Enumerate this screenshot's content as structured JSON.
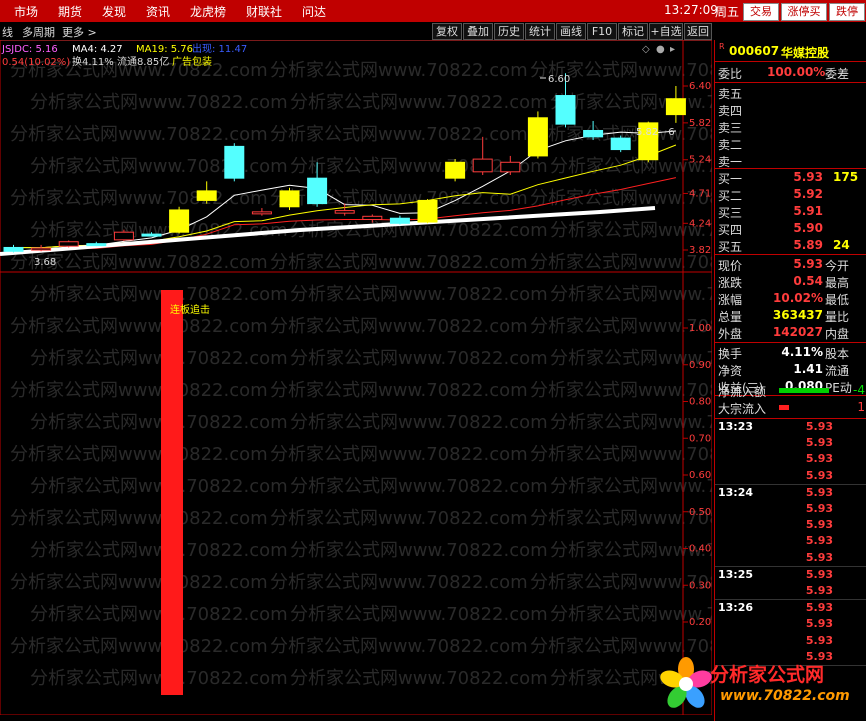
{
  "top_menu": [
    "市场",
    "期货",
    "发现",
    "资讯",
    "龙虎榜",
    "财联社",
    "问达"
  ],
  "clock": "13:27:09",
  "weekday": "周五",
  "top_buttons": [
    "交易",
    "涨停买",
    "跌停"
  ],
  "toolbar": {
    "period_left": "线",
    "period": "多周期",
    "more": "更多 >",
    "buttons": [
      "复权",
      "叠加",
      "历史",
      "统计",
      "画线",
      "F10",
      "标记",
      "+自选",
      "返回"
    ]
  },
  "indicator_line": {
    "name": "JSJDC: 5.16",
    "ma4": "MA4: 4.27",
    "ma19": "MA19: 5.76",
    "extra": "出现: 11.47",
    "change": "0.54(10.02%)",
    "turnover": "换4.11% 流通8.85亿",
    "concept": "广告包装"
  },
  "chart_labels": {
    "high_marker": "6.60",
    "low_marker": "3.68",
    "last_marker": "5.82 - 6",
    "signal_text": "连板追击"
  },
  "chart_data": {
    "type": "candlestick",
    "price_axis_ticks": [
      "6.40",
      "5.82",
      "5.24",
      "4.71",
      "4.24",
      "3.82"
    ],
    "indicator_axis_ticks": [
      "1.00",
      "0.90",
      "0.80",
      "0.70",
      "0.60",
      "0.50",
      "0.40",
      "0.30",
      "0.20"
    ],
    "candles": [
      {
        "o": 3.8,
        "c": 3.86,
        "h": 3.9,
        "l": 3.78,
        "color": "cyan"
      },
      {
        "o": 3.84,
        "c": 3.85,
        "h": 3.9,
        "l": 3.8,
        "color": "red"
      },
      {
        "o": 3.88,
        "c": 3.95,
        "h": 3.97,
        "l": 3.86,
        "color": "red"
      },
      {
        "o": 3.9,
        "c": 3.92,
        "h": 3.95,
        "l": 3.88,
        "color": "cyan"
      },
      {
        "o": 3.98,
        "c": 4.1,
        "h": 4.14,
        "l": 3.96,
        "color": "red"
      },
      {
        "o": 4.06,
        "c": 4.07,
        "h": 4.1,
        "l": 4.04,
        "color": "cyan"
      },
      {
        "o": 4.1,
        "c": 4.45,
        "h": 4.5,
        "l": 4.08,
        "color": "yellow"
      },
      {
        "o": 4.6,
        "c": 4.75,
        "h": 4.9,
        "l": 4.55,
        "color": "yellow"
      },
      {
        "o": 4.95,
        "c": 5.45,
        "h": 5.5,
        "l": 4.9,
        "color": "cyan"
      },
      {
        "o": 4.42,
        "c": 4.4,
        "h": 4.48,
        "l": 4.36,
        "color": "red"
      },
      {
        "o": 4.5,
        "c": 4.75,
        "h": 4.8,
        "l": 4.45,
        "color": "yellow"
      },
      {
        "o": 4.95,
        "c": 4.55,
        "h": 5.2,
        "l": 4.5,
        "color": "cyan"
      },
      {
        "o": 4.4,
        "c": 4.44,
        "h": 4.55,
        "l": 4.36,
        "color": "red"
      },
      {
        "o": 4.3,
        "c": 4.35,
        "h": 4.38,
        "l": 4.25,
        "color": "red"
      },
      {
        "o": 4.32,
        "c": 4.24,
        "h": 4.36,
        "l": 4.22,
        "color": "cyan"
      },
      {
        "o": 4.26,
        "c": 4.6,
        "h": 4.62,
        "l": 4.24,
        "color": "yellow"
      },
      {
        "o": 4.95,
        "c": 5.2,
        "h": 5.25,
        "l": 4.9,
        "color": "yellow"
      },
      {
        "o": 5.05,
        "c": 5.25,
        "h": 5.6,
        "l": 5.0,
        "color": "red"
      },
      {
        "o": 5.05,
        "c": 5.2,
        "h": 5.3,
        "l": 5.0,
        "color": "red"
      },
      {
        "o": 5.3,
        "c": 5.9,
        "h": 6.0,
        "l": 5.26,
        "color": "yellow"
      },
      {
        "o": 6.25,
        "c": 5.8,
        "h": 6.6,
        "l": 5.75,
        "color": "cyan"
      },
      {
        "o": 5.7,
        "c": 5.6,
        "h": 5.85,
        "l": 5.55,
        "color": "cyan"
      },
      {
        "o": 5.58,
        "c": 5.4,
        "h": 5.62,
        "l": 5.36,
        "color": "cyan"
      },
      {
        "o": 5.24,
        "c": 5.82,
        "h": 5.84,
        "l": 5.2,
        "color": "yellow"
      },
      {
        "o": 6.2,
        "c": 5.95,
        "h": 6.4,
        "l": 5.82,
        "color": "yellow"
      }
    ]
  },
  "panel": {
    "code": "000607",
    "name": "华媒控股",
    "weibi_label": "委比",
    "weibi_value": "100.00%",
    "weicha_label": "委差",
    "sell": [
      "卖五",
      "卖四",
      "卖三",
      "卖二",
      "卖一"
    ],
    "buy": [
      {
        "label": "买一",
        "price": "5.93",
        "vol": "175"
      },
      {
        "label": "买二",
        "price": "5.92",
        "vol": ""
      },
      {
        "label": "买三",
        "price": "5.91",
        "vol": ""
      },
      {
        "label": "买四",
        "price": "5.90",
        "vol": ""
      },
      {
        "label": "买五",
        "price": "5.89",
        "vol": "24"
      }
    ],
    "quotes": [
      {
        "label": "现价",
        "value": "5.93",
        "cls": "red",
        "ext": "今开"
      },
      {
        "label": "涨跌",
        "value": "0.54",
        "cls": "red",
        "ext": "最高"
      },
      {
        "label": "涨幅",
        "value": "10.02%",
        "cls": "red",
        "ext": "最低"
      },
      {
        "label": "总量",
        "value": "363437",
        "cls": "yel",
        "ext": "量比"
      },
      {
        "label": "外盘",
        "value": "142027",
        "cls": "red",
        "ext": "内盘"
      }
    ],
    "quotes2": [
      {
        "label": "换手",
        "value": "4.11%",
        "cls": "wht",
        "ext": "股本"
      },
      {
        "label": "净资",
        "value": "1.41",
        "cls": "wht",
        "ext": "流通"
      },
      {
        "label": "收益(三)",
        "value": "0.080",
        "cls": "wht",
        "ext": "PE动"
      }
    ],
    "flow": [
      {
        "label": "净流入额",
        "value": "-4",
        "bar": "green"
      },
      {
        "label": "大宗流入",
        "value": "1",
        "bar": "red"
      }
    ],
    "ticks": [
      {
        "time": "13:23",
        "prices": [
          "5.93",
          "5.93",
          "5.93",
          "5.93"
        ]
      },
      {
        "time": "13:24",
        "prices": [
          "5.93",
          "5.93",
          "5.93",
          "5.93",
          "5.93"
        ]
      },
      {
        "time": "13:25",
        "prices": [
          "5.93",
          "5.93"
        ]
      },
      {
        "time": "13:26",
        "prices": [
          "5.93",
          "5.93",
          "5.93",
          "5.93"
        ]
      }
    ]
  },
  "watermark": "分析家公式网www.70822.com",
  "logo": {
    "title": "分析家公式网",
    "url": "www.70822.com"
  }
}
